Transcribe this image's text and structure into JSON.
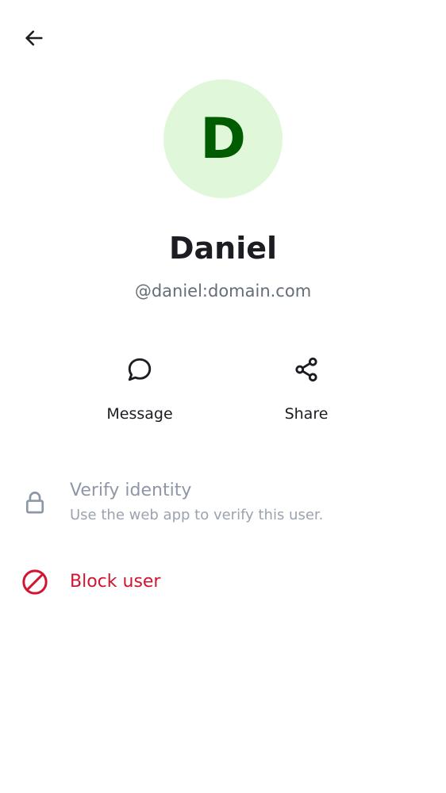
{
  "header": {
    "back_icon": "arrow-left-icon"
  },
  "profile": {
    "avatar_letter": "D",
    "avatar_bg": "#e0f8d9",
    "avatar_fg": "#005c00",
    "name": "Daniel",
    "user_id": "@daniel:domain.com"
  },
  "actions": {
    "message": {
      "label": "Message",
      "icon": "chat-bubble-icon"
    },
    "share": {
      "label": "Share",
      "icon": "share-icon"
    }
  },
  "verify": {
    "title": "Verify identity",
    "subtitle": "Use the web app to verify this user.",
    "icon": "lock-icon"
  },
  "block": {
    "title": "Block user",
    "icon": "block-icon",
    "color": "#d1142f"
  }
}
